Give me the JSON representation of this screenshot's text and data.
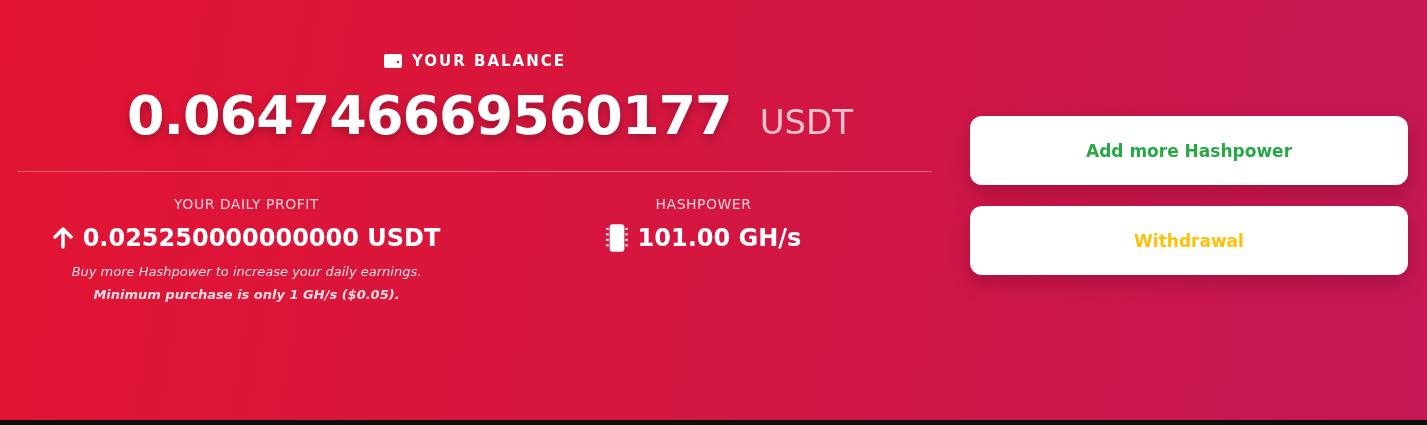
{
  "balance": {
    "label": "YOUR BALANCE",
    "amount": "0.064746669560177",
    "currency": "USDT"
  },
  "daily_profit": {
    "label": "YOUR DAILY PROFIT",
    "value": "0.025250000000000 USDT",
    "note": "Buy more Hashpower to increase your daily earnings.",
    "note_strong": "Minimum purchase is only 1 GH/s ($0.05)."
  },
  "hashpower": {
    "label": "HASHPOWER",
    "value": "101.00 GH/s"
  },
  "buttons": [
    {
      "label": "Add more Hashpower",
      "color": "#28a745"
    },
    {
      "label": "Withdrawal",
      "color": "#ffc107"
    }
  ]
}
